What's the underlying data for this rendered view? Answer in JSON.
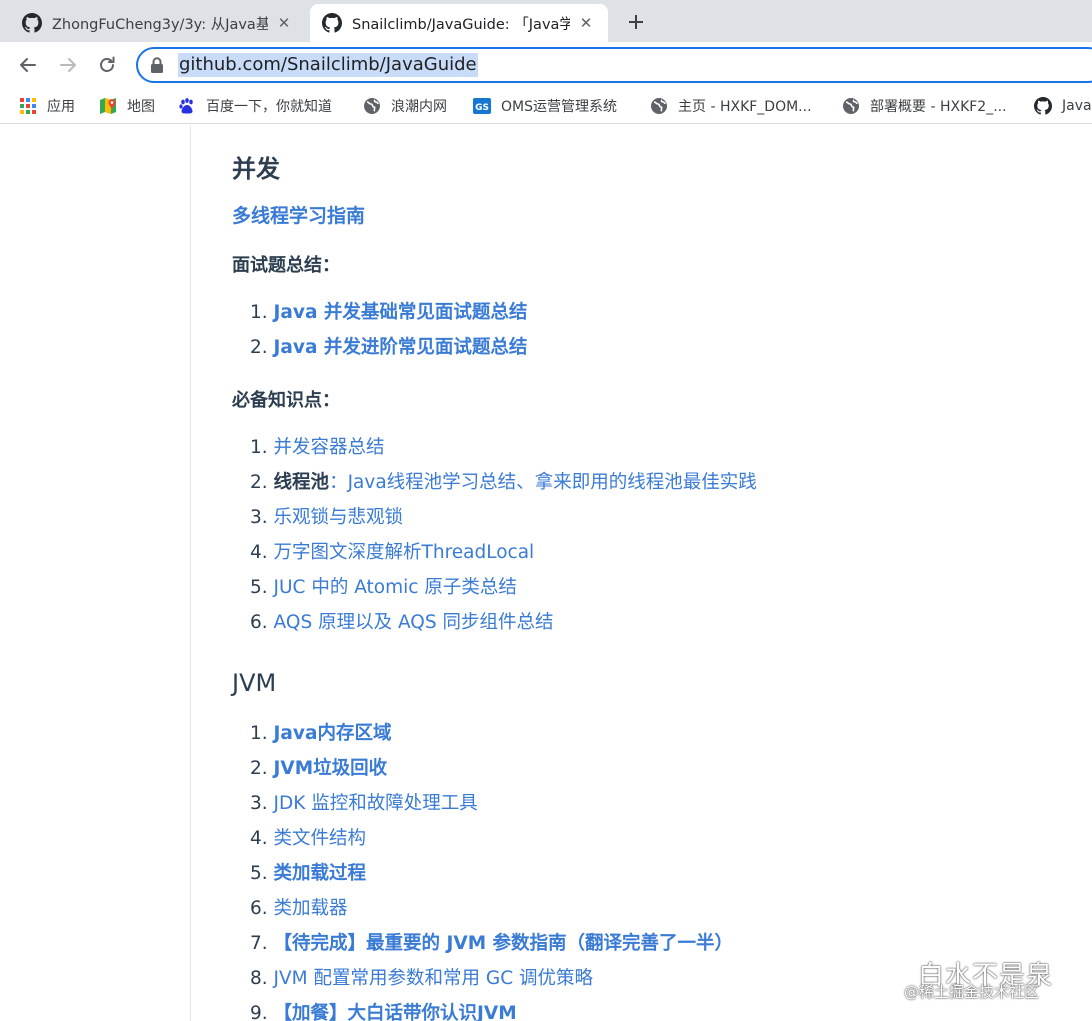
{
  "browser": {
    "tabs": [
      {
        "title": "ZhongFuCheng3y/3y: 从Java基",
        "active": false
      },
      {
        "title": "Snailclimb/JavaGuide: 「Java学",
        "active": true
      }
    ],
    "close_glyph": "✕",
    "url": "github.com/Snailclimb/JavaGuide",
    "bookmarks": [
      {
        "label": "应用",
        "icon": "apps-grid-icon"
      },
      {
        "label": "地图",
        "icon": "maps-icon"
      },
      {
        "label": "百度一下，你就知道",
        "icon": "baidu-paw-icon"
      },
      {
        "label": "浪潮内网",
        "icon": "globe-icon"
      },
      {
        "label": "OMS运营管理系统",
        "icon": "gs-logo-icon"
      },
      {
        "label": "主页 - HXKF_DOM...",
        "icon": "globe-icon"
      },
      {
        "label": "部署概要 - HXKF2_...",
        "icon": "globe-icon"
      },
      {
        "label": "Java",
        "icon": "github-icon"
      }
    ]
  },
  "content": {
    "concurrency_heading": "并发",
    "guide_link": "多线程学习指南",
    "interview_heading": "面试题总结：",
    "interview_items": [
      {
        "num": "1.",
        "text": "Java 并发基础常见面试题总结"
      },
      {
        "num": "2.",
        "text": "Java 并发进阶常见面试题总结"
      }
    ],
    "knowledge_heading": "必备知识点：",
    "knowledge_items": [
      {
        "num": "1.",
        "text": "并发容器总结"
      },
      {
        "num": "2.",
        "prefix": "线程池",
        "colon": "：",
        "link1": "Java线程池学习总结",
        "sep": "、",
        "link2": "拿来即用的线程池最佳实践"
      },
      {
        "num": "3.",
        "text": "乐观锁与悲观锁"
      },
      {
        "num": "4.",
        "text": "万字图文深度解析ThreadLocal"
      },
      {
        "num": "5.",
        "text": "JUC 中的 Atomic 原子类总结"
      },
      {
        "num": "6.",
        "text": "AQS 原理以及 AQS 同步组件总结"
      }
    ],
    "jvm_heading": "JVM",
    "jvm_items": [
      {
        "num": "1.",
        "text": "Java内存区域",
        "bold": true
      },
      {
        "num": "2.",
        "text": "JVM垃圾回收",
        "bold": true
      },
      {
        "num": "3.",
        "text": "JDK 监控和故障处理工具",
        "bold": false
      },
      {
        "num": "4.",
        "text": "类文件结构",
        "bold": false
      },
      {
        "num": "5.",
        "text": "类加载过程",
        "bold": true
      },
      {
        "num": "6.",
        "text": "类加载器",
        "bold": false
      },
      {
        "num": "7.",
        "text": "【待完成】最重要的 JVM 参数指南（翻译完善了一半）",
        "bold": true
      },
      {
        "num": "8.",
        "text": "JVM 配置常用参数和常用 GC 调优策略",
        "bold": false
      },
      {
        "num": "9.",
        "text": "【加餐】大白话带你认识JVM",
        "bold": true
      }
    ]
  },
  "watermark": {
    "name": "白水不是泉",
    "sub": "@稀土掘金技术社区"
  },
  "colors": {
    "link": "#3a7bd5",
    "heading": "#2c3e50",
    "tabstrip": "#dee1e6",
    "omnibox_border": "#1a73e8"
  }
}
